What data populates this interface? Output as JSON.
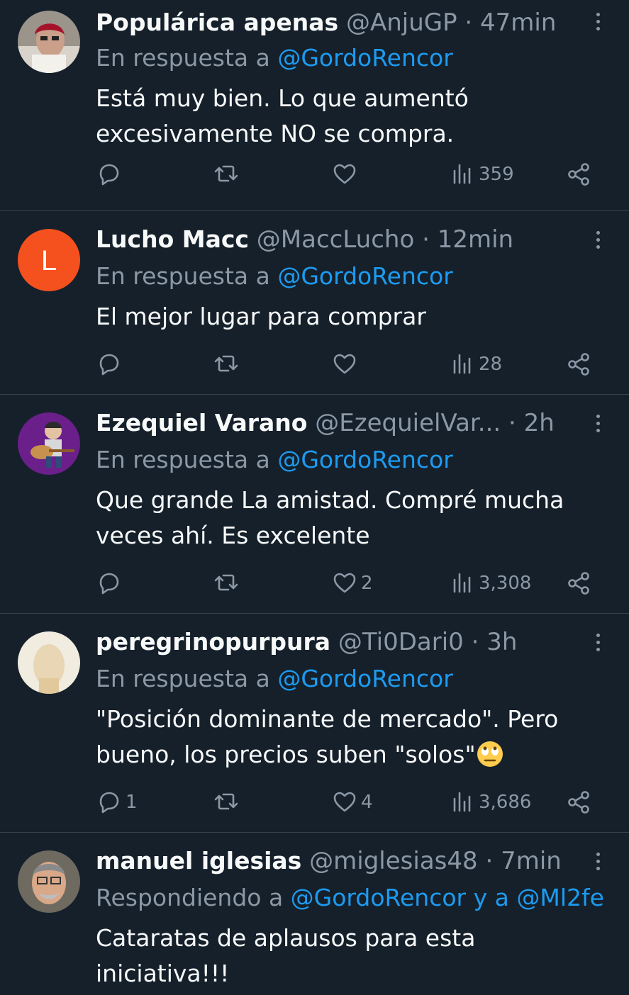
{
  "tweets": [
    {
      "name": "Populárica apenas",
      "handle": "@AnjuGP",
      "sep": "·",
      "time": "47min",
      "reply_prefix": "En respuesta a ",
      "reply_to": "@GordoRencor",
      "text_lines": [
        "Está muy bien. Lo que aumentó",
        "excesivamente NO se compra."
      ],
      "replies": "",
      "retweets": "",
      "likes": "",
      "views": "359"
    },
    {
      "name": "Lucho Macc",
      "handle": "@MaccLucho",
      "sep": "·",
      "time": "12min",
      "avatar_letter": "L",
      "reply_prefix": "En respuesta a ",
      "reply_to": "@GordoRencor",
      "text_lines": [
        "El mejor lugar para comprar"
      ],
      "replies": "",
      "retweets": "",
      "likes": "",
      "views": "28"
    },
    {
      "name": "Ezequiel Varano",
      "handle": "@EzequielVar...",
      "sep": "·",
      "time": "2h",
      "reply_prefix": "En respuesta a ",
      "reply_to": "@GordoRencor",
      "text_lines": [
        "Que grande La amistad. Compré mucha",
        "veces ahí. Es excelente"
      ],
      "replies": "",
      "retweets": "",
      "likes": "2",
      "views": "3,308"
    },
    {
      "name": "peregrinopurpura",
      "handle": "@Ti0Dari0",
      "sep": "·",
      "time": "3h",
      "reply_prefix": "En respuesta a ",
      "reply_to": "@GordoRencor",
      "text_lines": [
        "\"Posición dominante de mercado\". Pero",
        "bueno, los precios suben \"solos\""
      ],
      "replies": "1",
      "retweets": "",
      "likes": "4",
      "views": "3,686"
    },
    {
      "name": "manuel iglesias",
      "handle": "@miglesias48",
      "sep": "·",
      "time": "7min",
      "reply_prefix": "Respondiendo a ",
      "reply_to": "@GordoRencor y a @Ml2fe",
      "text_lines": [
        "Cataratas de aplausos para esta",
        "iniciativa!!!"
      ],
      "replies": "",
      "retweets": "",
      "likes": "",
      "views": ""
    }
  ],
  "colors": {
    "background": "#15202b",
    "accent": "#1d9bf0",
    "muted": "#8b98a5",
    "divider": "#38444d"
  },
  "icons": [
    "reply-icon",
    "retweet-icon",
    "like-icon",
    "views-icon",
    "share-icon",
    "more-icon"
  ]
}
